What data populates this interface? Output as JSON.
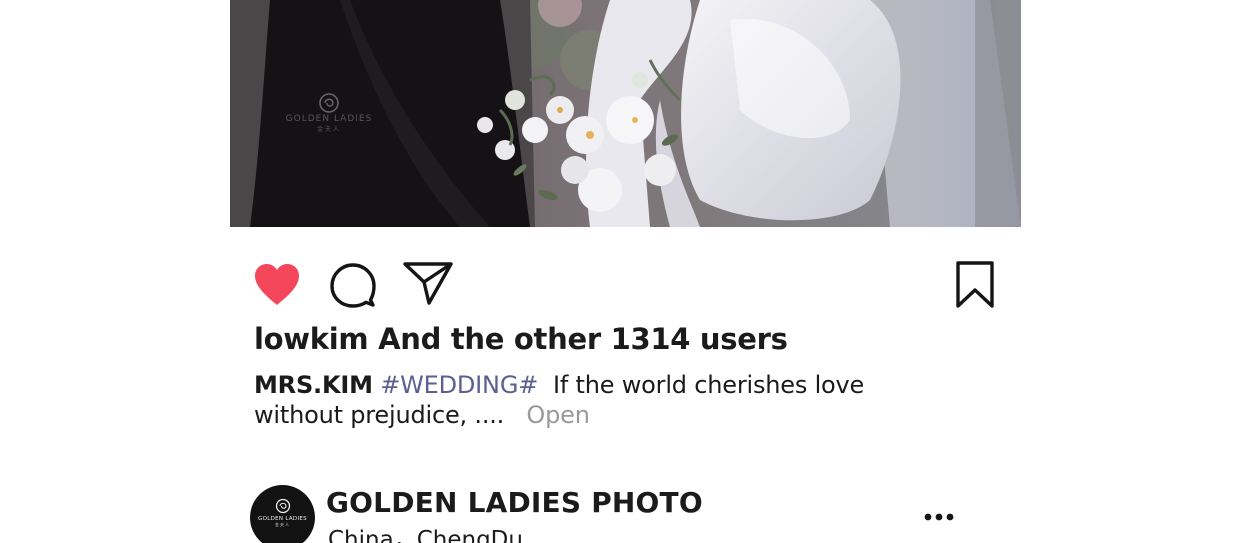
{
  "post": {
    "photo_alt": "wedding-photo",
    "watermark": {
      "brand": "GOLDEN LADIES",
      "sub": "金夫人"
    },
    "actions": {
      "like_icon": "heart-icon",
      "comment_icon": "comment-icon",
      "share_icon": "paper-plane-icon",
      "save_icon": "bookmark-icon",
      "liked": true,
      "like_color": "#f5475c"
    },
    "likes_text": "lowkim And the other 1314 users",
    "caption": {
      "username": "MRS.KIM",
      "hashtag": "#WEDDING#",
      "text": "If the world cherishes love without prejudice, ....",
      "more_label": "Open"
    }
  },
  "next_post": {
    "avatar": {
      "brand": "GOLDEN LADIES",
      "sub": "金夫人"
    },
    "account_name": "GOLDEN LADIES PHOTO",
    "location": "China，ChengDu",
    "more_icon": "more-dots-icon"
  },
  "colors": {
    "hashtag": "#5b5f93",
    "muted": "#9a9a9a",
    "text": "#1b1b1b"
  }
}
